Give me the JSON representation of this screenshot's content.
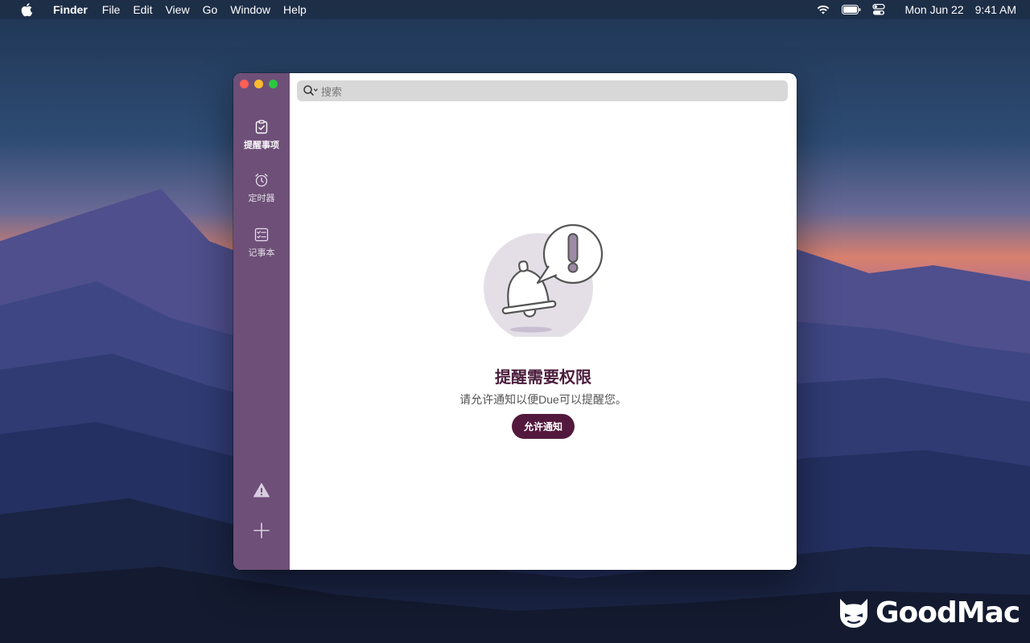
{
  "menubar": {
    "app_name": "Finder",
    "items": [
      "File",
      "Edit",
      "View",
      "Go",
      "Window",
      "Help"
    ],
    "date": "Mon Jun 22",
    "time": "9:41 AM"
  },
  "sidebar": {
    "items": [
      {
        "label": "提醒事项",
        "icon": "reminders-icon"
      },
      {
        "label": "定时器",
        "icon": "alarm-clock-icon"
      },
      {
        "label": "记事本",
        "icon": "checklist-icon"
      }
    ]
  },
  "search": {
    "placeholder": "搜索"
  },
  "empty_state": {
    "title": "提醒需要权限",
    "subtitle": "请允许通知以便Due可以提醒您。",
    "button_label": "允许通知"
  },
  "watermark": {
    "text": "GoodMac"
  },
  "colors": {
    "sidebar": "#6e4f78",
    "accent": "#53183d",
    "title": "#4b1d3c"
  }
}
